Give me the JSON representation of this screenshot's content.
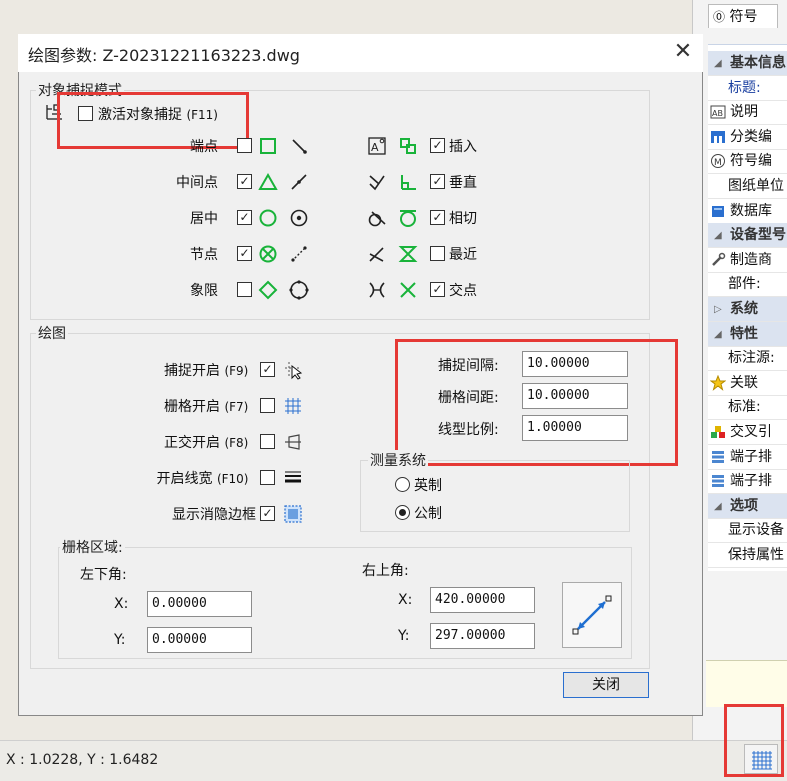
{
  "dialog": {
    "title": "绘图参数: Z-20231221163223.dwg",
    "close_label": "关闭",
    "snap_group": {
      "label": "对象捕捉模式",
      "activate_label": "激活对象捕捉",
      "activate_key": "(F11)",
      "activate_checked": false,
      "left_items": [
        {
          "label": "端点",
          "checked": false,
          "icon": "endpoint-square-icon"
        },
        {
          "label": "中间点",
          "checked": true,
          "icon": "midpoint-triangle-icon"
        },
        {
          "label": "居中",
          "checked": true,
          "icon": "center-circle-icon"
        },
        {
          "label": "节点",
          "checked": true,
          "icon": "node-x-circle-icon"
        },
        {
          "label": "象限",
          "checked": false,
          "icon": "quadrant-diamond-icon"
        }
      ],
      "right_items": [
        {
          "label": "插入",
          "checked": true,
          "icon": "insert-icon"
        },
        {
          "label": "垂直",
          "checked": true,
          "icon": "perpendicular-icon"
        },
        {
          "label": "相切",
          "checked": true,
          "icon": "tangent-icon"
        },
        {
          "label": "最近",
          "checked": false,
          "icon": "nearest-hourglass-icon"
        },
        {
          "label": "交点",
          "checked": true,
          "icon": "intersection-x-icon"
        }
      ]
    },
    "draw_group": {
      "label": "绘图",
      "options": [
        {
          "label": "捕捉开启",
          "key": "(F9)",
          "checked": true,
          "icon": "snap-grid-cursor-icon"
        },
        {
          "label": "栅格开启",
          "key": "(F7)",
          "checked": false,
          "icon": "grid-icon"
        },
        {
          "label": "正交开启",
          "key": "(F8)",
          "checked": false,
          "icon": "ortho-icon"
        },
        {
          "label": "开启线宽",
          "key": "(F10)",
          "checked": false,
          "icon": "lineweight-icon"
        },
        {
          "label": "显示消隐边框",
          "key": "",
          "checked": true,
          "icon": "hidden-border-icon"
        }
      ],
      "snap_interval_label": "捕捉间隔:",
      "snap_interval_value": "10.00000",
      "grid_spacing_label": "栅格间距:",
      "grid_spacing_value": "10.00000",
      "linetype_scale_label": "线型比例:",
      "linetype_scale_value": "1.00000",
      "measure": {
        "label": "测量系统",
        "imperial": "英制",
        "metric": "公制",
        "selected": "公制"
      },
      "grid_area": {
        "label": "栅格区域:",
        "lower_left_label": "左下角:",
        "upper_right_label": "右上角:",
        "x_label": "X:",
        "y_label": "Y:",
        "ll_x": "0.00000",
        "ll_y": "0.00000",
        "ur_x": "420.00000",
        "ur_y": "297.00000"
      }
    }
  },
  "right_panel": {
    "tab_label": "符号",
    "rows": [
      {
        "type": "cat",
        "label": "基本信息"
      },
      {
        "type": "item",
        "label": "标题:",
        "blue": true
      },
      {
        "type": "item",
        "label": "说明",
        "icon": "text-ab-icon"
      },
      {
        "type": "item",
        "label": "分类编",
        "icon": "category-icon"
      },
      {
        "type": "item",
        "label": "符号编",
        "icon": "symbol-m-icon"
      },
      {
        "type": "item",
        "label": "图纸单位"
      },
      {
        "type": "item",
        "label": "数据库",
        "icon": "database-icon"
      },
      {
        "type": "cat",
        "label": "设备型号"
      },
      {
        "type": "item",
        "label": "制造商",
        "icon": "wrench-icon"
      },
      {
        "type": "item",
        "label": "部件:"
      },
      {
        "type": "cat",
        "label": "系统",
        "collapsed": true
      },
      {
        "type": "cat",
        "label": "特性"
      },
      {
        "type": "item",
        "label": "标注源:"
      },
      {
        "type": "item",
        "label": "关联",
        "icon": "star-icon"
      },
      {
        "type": "item",
        "label": "标准:"
      },
      {
        "type": "item",
        "label": "交叉引",
        "icon": "cross-ref-icon"
      },
      {
        "type": "item",
        "label": "端子排",
        "icon": "terminal-icon"
      },
      {
        "type": "item",
        "label": "端子排",
        "icon": "terminal-icon"
      },
      {
        "type": "cat",
        "label": "选项"
      },
      {
        "type": "item",
        "label": "显示设备"
      },
      {
        "type": "item",
        "label": "保持属性"
      }
    ]
  },
  "status_bar": {
    "coords": "X : 1.0228, Y : 1.6482"
  },
  "colors": {
    "accent_red": "#e53935",
    "snap_green": "#19b33a",
    "border_blue": "#2a6fcf"
  }
}
